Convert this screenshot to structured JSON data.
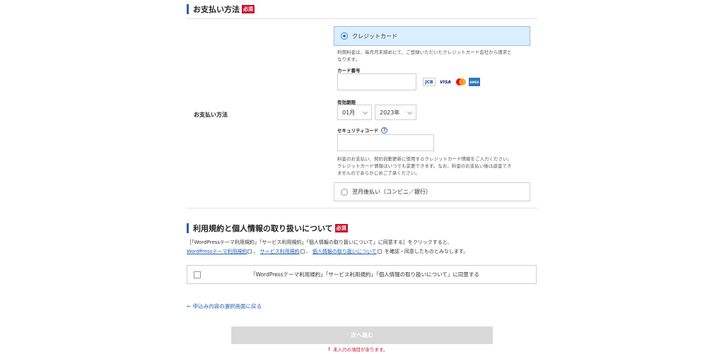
{
  "payment": {
    "section_title": "お支払い方法",
    "required_badge": "必須",
    "row_label": "お支払い方法",
    "option_credit": "クレジットカード",
    "credit_note_1": "利用料金は、毎月月末締めにて、ご登録いただいたクレジットカード会社から請求と",
    "credit_note_2": "なります。",
    "card_number_label": "カード番号",
    "card_brands": [
      "JCB",
      "VISA",
      "MC",
      "AMEX"
    ],
    "expiry_label": "有効期限",
    "expiry_month": "01月",
    "expiry_year": "2023年",
    "security_label": "セキュリティコード",
    "security_help": "?",
    "security_note_1": "料金のお支払い、契約自動更新に使用するクレジットカード情報をご入力ください。",
    "security_note_2": "クレジットカード情報はいつでも変更できます。なお、料金のお支払い後は返金でき",
    "security_note_3": "ませんのであらかじめご了承ください。",
    "option_postpay": "翌月後払い（コンビニ／銀行）"
  },
  "terms": {
    "section_title": "利用規約と個人情報の取り扱いについて",
    "required_badge": "必須",
    "intro": "［「WordPressテーマ利用規約」「サービス利用規約」「個人情報の取り扱いについて」に同意する］をクリックすると、",
    "link_theme": "WordPressテーマ利用規約",
    "sep1": "、",
    "link_service": "サービス利用規約",
    "sep2": "、",
    "link_privacy": "個人情報の取り扱いについて",
    "outro": "を確認・同意したものとみなします。",
    "agree_label": "「WordPressテーマ利用規約」「サービス利用規約」「個人情報の取り扱いについて」に同意する"
  },
  "footer": {
    "back_link": "← 申込み内容の選択画面に戻る",
    "next_button": "次へ進む",
    "error_icon": "!",
    "error_text": "未入力の項目があります。"
  },
  "colors": {
    "accent": "#2b5fa8",
    "required": "#c8102e",
    "selected_bg": "#dbeeff",
    "link": "#1a5fb4"
  }
}
